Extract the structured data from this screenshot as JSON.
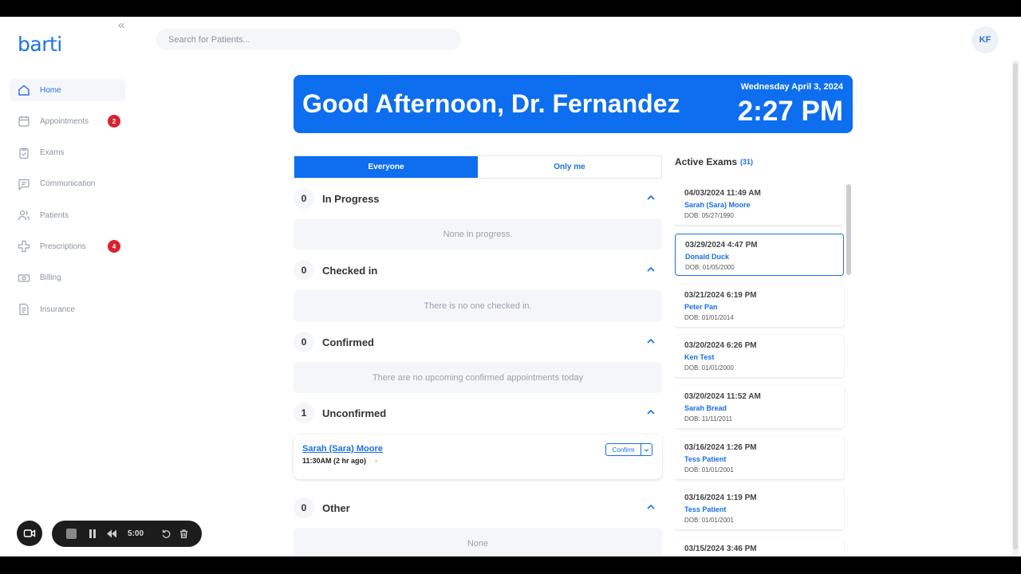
{
  "app": {
    "logo": "barti",
    "collapse_glyph": "«",
    "search_placeholder": "Search for Patients...",
    "avatar_initials": "KF"
  },
  "sidebar": {
    "items": [
      {
        "label": "Home",
        "icon": "home-icon",
        "active": true
      },
      {
        "label": "Appointments",
        "icon": "calendar-icon",
        "badge": "2"
      },
      {
        "label": "Exams",
        "icon": "clipboard-icon"
      },
      {
        "label": "Communication",
        "icon": "chat-icon"
      },
      {
        "label": "Patients",
        "icon": "users-icon"
      },
      {
        "label": "Prescriptions",
        "icon": "cross-icon",
        "badge": "4"
      },
      {
        "label": "Billing",
        "icon": "money-icon"
      },
      {
        "label": "Insurance",
        "icon": "document-icon"
      }
    ]
  },
  "banner": {
    "greeting": "Good Afternoon, Dr. Fernandez",
    "date": "Wednesday April 3, 2024",
    "time": "2:27 PM",
    "color": "#0d6ef0"
  },
  "toggle": {
    "everyone": "Everyone",
    "only_me": "Only me"
  },
  "sections": {
    "in_progress": {
      "count": "0",
      "title": "In Progress",
      "empty": "None in progress."
    },
    "checked_in": {
      "count": "0",
      "title": "Checked in",
      "empty": "There is no one checked in."
    },
    "confirmed": {
      "count": "0",
      "title": "Confirmed",
      "empty": "There are no upcoming confirmed appointments today"
    },
    "unconfirmed": {
      "count": "1",
      "title": "Unconfirmed"
    },
    "other": {
      "count": "0",
      "title": "Other",
      "empty": "None"
    }
  },
  "unconfirmed_appt": {
    "name": "Sarah (Sara) Moore",
    "time": "11:30AM (2 hr ago)",
    "dash": "-",
    "confirm_label": "Confirm"
  },
  "exams": {
    "title": "Active Exams",
    "count": "(31)",
    "items": [
      {
        "date": "04/03/2024 11:49 AM",
        "name": "Sarah (Sara) Moore",
        "dob": "DOB: 05/27/1990"
      },
      {
        "date": "03/29/2024 4:47 PM",
        "name": "Donald Duck",
        "dob": "DOB: 01/05/2000",
        "selected": true
      },
      {
        "date": "03/21/2024 6:19 PM",
        "name": "Peter Pan",
        "dob": "DOB: 01/01/2014"
      },
      {
        "date": "03/20/2024 6:26 PM",
        "name": "Ken Test",
        "dob": "DOB: 01/01/2000"
      },
      {
        "date": "03/20/2024 11:52 AM",
        "name": "Sarah Bread",
        "dob": "DOB: 11/11/2011"
      },
      {
        "date": "03/16/2024 1:26 PM",
        "name": "Tess Patient",
        "dob": "DOB: 01/01/2001"
      },
      {
        "date": "03/16/2024 1:19 PM",
        "name": "Tess Patient",
        "dob": "DOB: 01/01/2001"
      },
      {
        "date": "03/15/2024 3:46 PM",
        "name": "",
        "dob": ""
      }
    ]
  },
  "recorder": {
    "time": "5:00"
  }
}
